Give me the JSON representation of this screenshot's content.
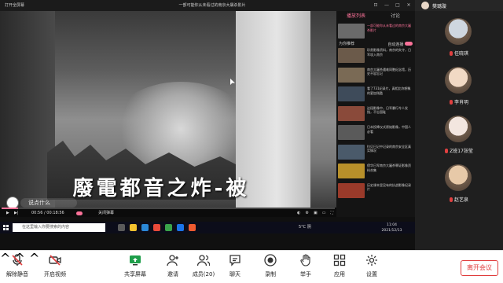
{
  "browser": {
    "tab_label": "打开全屏幕",
    "title": "一部可能你从未看过的南京大屠杀影片"
  },
  "video": {
    "caption": "廢電都音之炸-被",
    "danmaku_placeholder": "说点什么",
    "time": "00:56 / 00:18:56",
    "progress": 0.05,
    "danmu_label": "关闭弹幕"
  },
  "side_panel": {
    "tabs": [
      "播放列表",
      "讨论"
    ],
    "top_item": "一部可能你从未看过的南京大屠杀影片",
    "autoplay_label": "为你推荐",
    "autoplay_toggle_label": "自动连播",
    "recommendations": [
      {
        "text": "珍贵影像资料，南京的失守，日军攻入南京",
        "color": "#6b5a4a"
      },
      {
        "text": "南京大屠杀遇难同胞纪念馆，历史不容忘记",
        "color": "#7a6a55"
      },
      {
        "text": "看了731纪录片，真相比你想象的更加残酷",
        "color": "#3e4b5a"
      },
      {
        "text": "这段影像中，日军暴行令人发指，不忘国耻",
        "color": "#8a4a3a"
      },
      {
        "text": "日本投降仪式原始影像，中国人必看",
        "color": "#5a5a5a"
      },
      {
        "text": "拉贝日记中记录的南京安全区真实情况",
        "color": "#4a5a6a"
      },
      {
        "text": "侵华日军南京大屠杀罪证影像资料合集",
        "color": "#b8902a"
      },
      {
        "text": "历史课本里没有的抗战影像纪录片",
        "color": "#9a3a2a"
      }
    ]
  },
  "taskbar": {
    "search_placeholder": "在这里输入你要搜索的内容",
    "weather": "5°C 阴",
    "time": "11:04",
    "date": "2021/12/13"
  },
  "participants": {
    "host": "樊璐璇",
    "list": [
      {
        "name": "任晓琪",
        "color": "#cfd7e0"
      },
      {
        "name": "李肖明",
        "color": "#f1d9c4"
      },
      {
        "name": "Z班17张莹",
        "color": "#f3e6df"
      },
      {
        "name": "赵艺泉",
        "color": "#e7c9a8"
      }
    ]
  },
  "toolbar": {
    "mute": "解除静音",
    "video": "开启视频",
    "share": "共享屏幕",
    "invite": "邀请",
    "members": "成员(20)",
    "chat": "聊天",
    "record": "录制",
    "raise_hand": "举手",
    "apps": "应用",
    "settings": "设置",
    "leave": "离开会议"
  },
  "colors": {
    "accent": "#fb7299",
    "danger": "#e03c3c"
  }
}
